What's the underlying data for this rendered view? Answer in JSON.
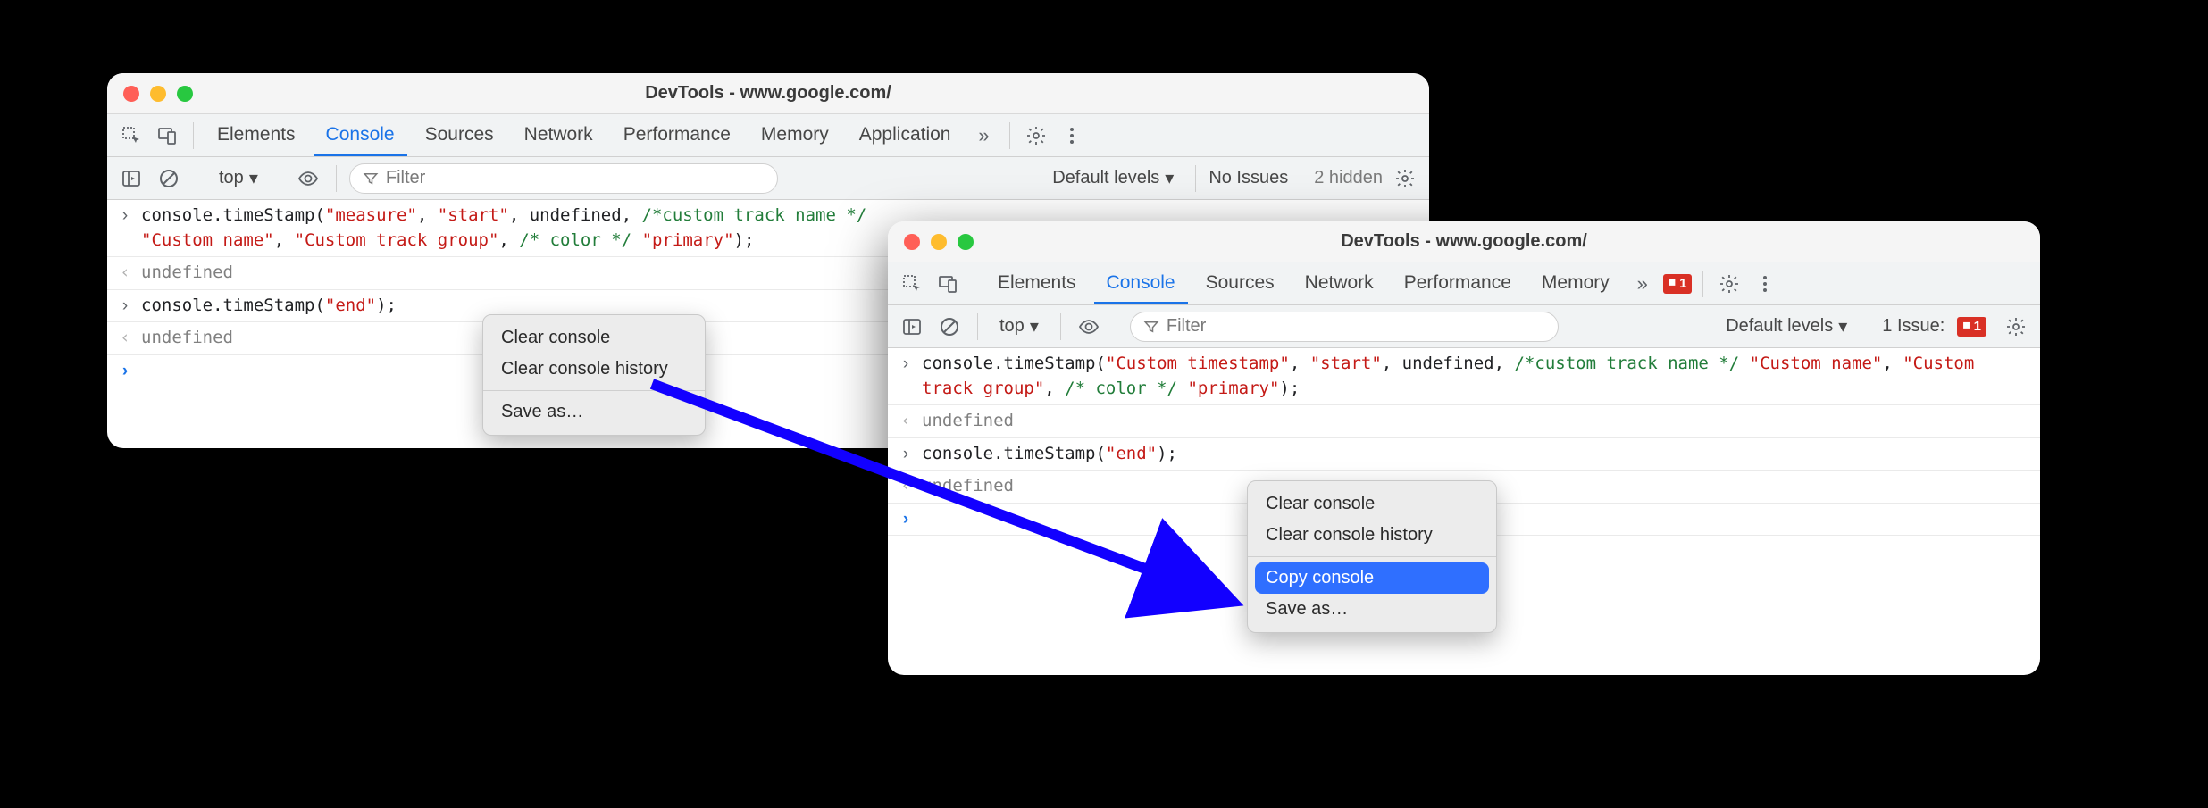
{
  "window_left": {
    "title": "DevTools - www.google.com/",
    "tabs": [
      "Elements",
      "Console",
      "Sources",
      "Network",
      "Performance",
      "Memory",
      "Application"
    ],
    "active_tab_index": 1,
    "toolbar": {
      "context": "top",
      "filter_placeholder": "Filter",
      "levels": "Default levels",
      "issues": "No Issues",
      "hidden": "2 hidden"
    },
    "console_lines": [
      {
        "caret": ">",
        "segments": [
          {
            "t": "console.timeStamp(",
            "c": "kw"
          },
          {
            "t": "\"measure\"",
            "c": "str"
          },
          {
            "t": ", ",
            "c": "kw"
          },
          {
            "t": "\"start\"",
            "c": "str"
          },
          {
            "t": ", undefined, ",
            "c": "kw"
          },
          {
            "t": "/*custom track name */",
            "c": "cmt"
          },
          {
            "t": " ",
            "c": "kw"
          },
          {
            "t": "\"Custom name\"",
            "c": "str"
          },
          {
            "t": ", ",
            "c": "kw"
          },
          {
            "t": "\"Custom track group\"",
            "c": "str"
          },
          {
            "t": ", ",
            "c": "kw"
          },
          {
            "t": "/* color */",
            "c": "cmt"
          },
          {
            "t": " ",
            "c": "kw"
          },
          {
            "t": "\"primary\"",
            "c": "str"
          },
          {
            "t": ");",
            "c": "kw"
          }
        ]
      },
      {
        "caret": "<",
        "segments": [
          {
            "t": "undefined",
            "c": "und"
          }
        ]
      },
      {
        "caret": ">",
        "segments": [
          {
            "t": "console.timeStamp(",
            "c": "kw"
          },
          {
            "t": "\"end\"",
            "c": "str"
          },
          {
            "t": ");",
            "c": "kw"
          }
        ]
      },
      {
        "caret": "<",
        "segments": [
          {
            "t": "undefined",
            "c": "und"
          }
        ]
      },
      {
        "caret": ">",
        "prompt": true,
        "segments": []
      }
    ],
    "context_menu": {
      "items": [
        {
          "label": "Clear console"
        },
        {
          "label": "Clear console history"
        },
        {
          "sep": true
        },
        {
          "label": "Save as…"
        }
      ]
    }
  },
  "window_right": {
    "title": "DevTools - www.google.com/",
    "tabs": [
      "Elements",
      "Console",
      "Sources",
      "Network",
      "Performance",
      "Memory"
    ],
    "active_tab_index": 1,
    "badge_count": "1",
    "toolbar": {
      "context": "top",
      "filter_placeholder": "Filter",
      "levels": "Default levels",
      "issues_label": "1 Issue:",
      "issues_badge": "1"
    },
    "console_lines": [
      {
        "caret": ">",
        "segments": [
          {
            "t": "console.timeStamp(",
            "c": "kw"
          },
          {
            "t": "\"Custom timestamp\"",
            "c": "str"
          },
          {
            "t": ", ",
            "c": "kw"
          },
          {
            "t": "\"start\"",
            "c": "str"
          },
          {
            "t": ", undefined, ",
            "c": "kw"
          },
          {
            "t": "/*custom track name */",
            "c": "cmt"
          },
          {
            "t": " ",
            "c": "kw"
          },
          {
            "t": "\"Custom name\"",
            "c": "str"
          },
          {
            "t": ", ",
            "c": "kw"
          },
          {
            "t": "\"Custom track group\"",
            "c": "str"
          },
          {
            "t": ", ",
            "c": "kw"
          },
          {
            "t": "/* color */",
            "c": "cmt"
          },
          {
            "t": " ",
            "c": "kw"
          },
          {
            "t": "\"primary\"",
            "c": "str"
          },
          {
            "t": ");",
            "c": "kw"
          }
        ]
      },
      {
        "caret": "<",
        "segments": [
          {
            "t": "undefined",
            "c": "und"
          }
        ]
      },
      {
        "caret": ">",
        "segments": [
          {
            "t": "console.timeStamp(",
            "c": "kw"
          },
          {
            "t": "\"end\"",
            "c": "str"
          },
          {
            "t": ");",
            "c": "kw"
          }
        ]
      },
      {
        "caret": "<",
        "segments": [
          {
            "t": "undefined",
            "c": "und"
          }
        ]
      },
      {
        "caret": ">",
        "prompt": true,
        "segments": []
      }
    ],
    "context_menu": {
      "items": [
        {
          "label": "Clear console"
        },
        {
          "label": "Clear console history"
        },
        {
          "sep": true
        },
        {
          "label": "Copy console",
          "highlight": true
        },
        {
          "label": "Save as…"
        }
      ]
    }
  }
}
